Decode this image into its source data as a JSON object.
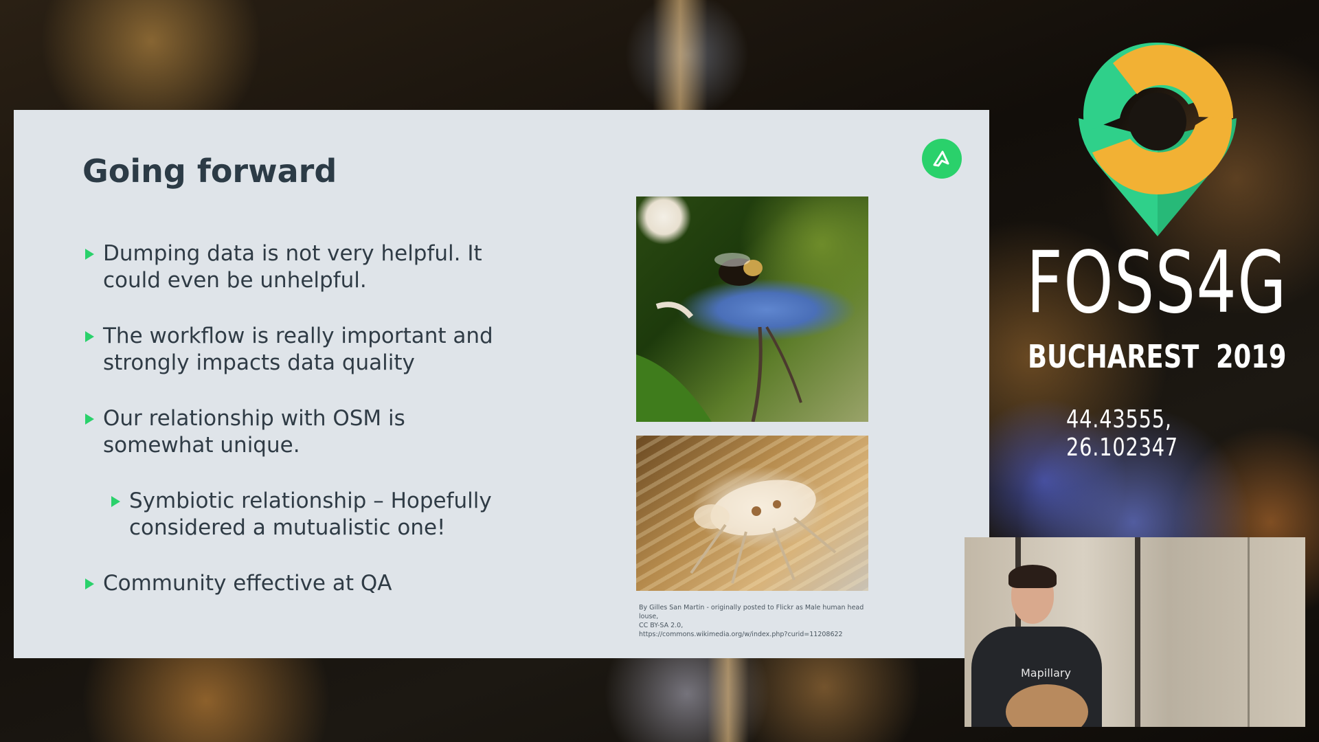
{
  "slide": {
    "title": "Going forward",
    "bullets": [
      {
        "text": "Dumping data is not very helpful. It could even be unhelpful.",
        "level": 1
      },
      {
        "text": "The workflow is really important and strongly impacts data quality",
        "level": 1
      },
      {
        "text": "Our relationship with OSM is somewhat unique.",
        "level": 1
      },
      {
        "text": "Symbiotic relationship – Hopefully considered a mutualistic one!",
        "level": 2
      },
      {
        "text": "Community effective at QA",
        "level": 1
      }
    ],
    "image_credit": {
      "line1": "By Gilles San Martin - originally posted to Flickr as Male human head louse,",
      "line2": "CC BY-SA 2.0,",
      "line3": "https://commons.wikimedia.org/w/index.php?curid=11208622"
    },
    "logo_icon": "mapillary-icon",
    "accent_color": "#2ad16b"
  },
  "branding": {
    "event": "FOSS4G",
    "city": "BUCHAREST",
    "year": "2019",
    "coordinates": "44.43555, 26.102347",
    "logo_colors": {
      "green": "#2fd08a",
      "gold": "#f2b134"
    }
  },
  "webcam": {
    "shirt_text": "Mapillary"
  }
}
